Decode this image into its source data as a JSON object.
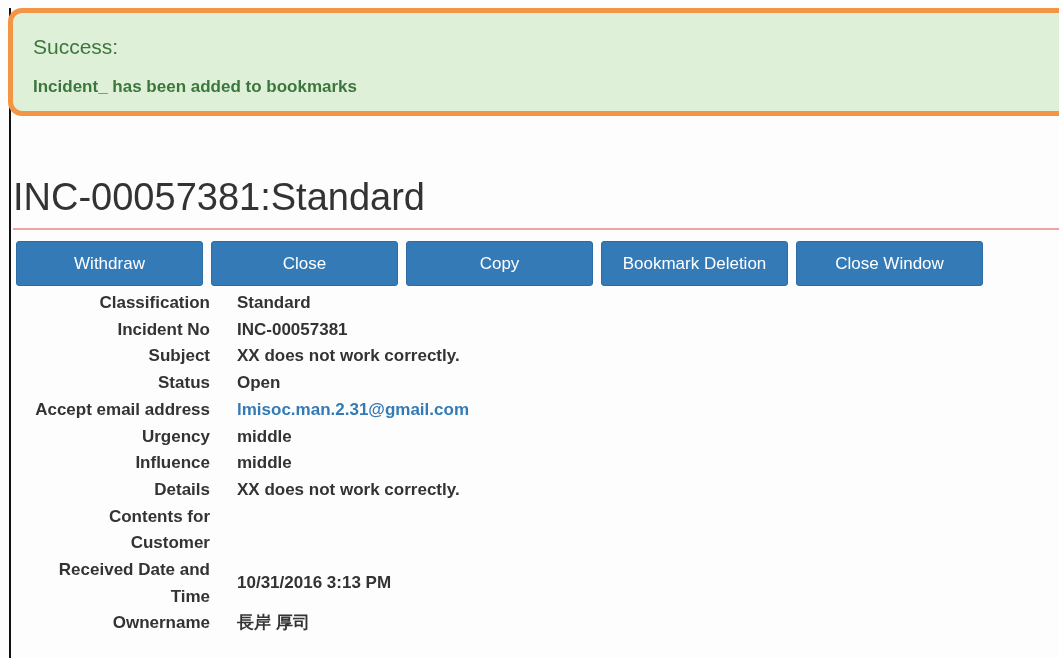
{
  "alert": {
    "kind": "success",
    "heading": "Success:",
    "message": "Incident_ has been added to bookmarks"
  },
  "title": "INC-00057381:Standard",
  "buttons": [
    "Withdraw",
    "Close",
    "Copy",
    "Bookmark Deletion",
    "Close Window"
  ],
  "details": [
    {
      "label": "Classification",
      "value": "Standard",
      "kind": "text"
    },
    {
      "label": "Incident No",
      "value": "INC-00057381",
      "kind": "text"
    },
    {
      "label": "Subject",
      "value": "XX does not work correctly.",
      "kind": "text"
    },
    {
      "label": "Status",
      "value": "Open",
      "kind": "text"
    },
    {
      "label": "Accept email address",
      "value": "lmisoc.man.2.31@gmail.com",
      "kind": "link"
    },
    {
      "label": "Urgency",
      "value": "middle",
      "kind": "text"
    },
    {
      "label": "Influence",
      "value": "middle",
      "kind": "text"
    },
    {
      "label": "Details",
      "value": "XX does not work correctly.",
      "kind": "text"
    },
    {
      "label": "Contents for\nCustomer",
      "kind": "text"
    },
    {
      "label": "Received Date and\nTime",
      "value": "10/31/2016 3:13 PM",
      "kind": "text"
    },
    {
      "label": "Ownername",
      "value": "長岸 厚司",
      "kind": "text"
    }
  ]
}
